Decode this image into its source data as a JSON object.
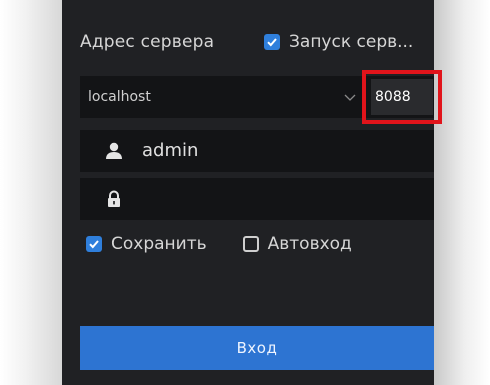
{
  "login": {
    "server_label": "Адрес сервера",
    "autostart_label": "Запуск серв...",
    "autostart_checked": true,
    "host": "localhost",
    "port": "8088",
    "username": "admin",
    "password_mask": "",
    "save_label": "Сохранить",
    "save_checked": true,
    "autologin_label": "Автовход",
    "autologin_checked": false,
    "login_button": "Вход"
  },
  "colors": {
    "panel_bg": "#202124",
    "field_bg": "#131416",
    "accent": "#2d74d2",
    "highlight": "#e1141b"
  },
  "icons": {
    "user": "user-icon",
    "lock": "lock-icon",
    "dropdown": "chevron-down-icon",
    "check": "check-icon"
  }
}
